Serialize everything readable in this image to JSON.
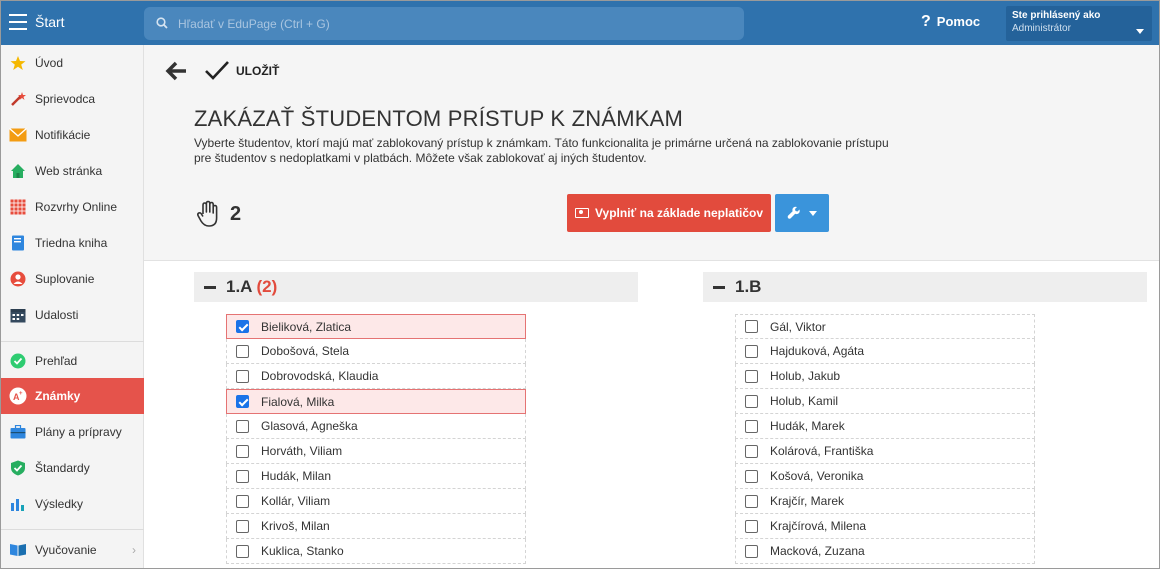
{
  "topbar": {
    "start_label": "Štart",
    "search_placeholder": "Hľadať v EduPage (Ctrl + G)",
    "help_label": "Pomoc",
    "user_line1": "Ste prihlásený ako",
    "user_line2": "Administrátor"
  },
  "sidebar": {
    "items": [
      {
        "label": "Úvod",
        "icon": "star-icon"
      },
      {
        "label": "Sprievodca",
        "icon": "magic-wand-icon"
      },
      {
        "label": "Notifikácie",
        "icon": "envelope-icon"
      },
      {
        "label": "Web stránka",
        "icon": "house-icon"
      },
      {
        "label": "Rozvrhy Online",
        "icon": "timetable-icon"
      },
      {
        "label": "Triedna kniha",
        "icon": "book-icon"
      },
      {
        "label": "Suplovanie",
        "icon": "substitute-icon"
      },
      {
        "label": "Udalosti",
        "icon": "calendar-icon"
      },
      {
        "label": "Prehľad",
        "icon": "check-circle-icon"
      },
      {
        "label": "Známky",
        "icon": "grades-icon"
      },
      {
        "label": "Plány a prípravy",
        "icon": "briefcase-icon"
      },
      {
        "label": "Štandardy",
        "icon": "shield-check-icon"
      },
      {
        "label": "Výsledky",
        "icon": "bar-chart-icon"
      },
      {
        "label": "Vyučovanie",
        "icon": "open-book-icon"
      }
    ],
    "active_index": 9
  },
  "toolbar": {
    "save_label": "ULOŽIŤ"
  },
  "page": {
    "title": "ZAKÁZAŤ ŠTUDENTOM PRÍSTUP K ZNÁMKAM",
    "description": "Vyberte študentov, ktorí majú mať zablokovaný prístup k známkam. Táto funkcionalita je primárne určená na zablokovanie prístupu pre študentov s nedoplatkami v platbách. Môžete však zablokovať aj iných študentov.",
    "blocked_count": "2",
    "fill_button_label": "Vyplniť na základe neplatičov"
  },
  "classes": [
    {
      "name": "1.A",
      "count_label": "(2)",
      "students": [
        {
          "name": "Bieliková, Zlatica",
          "checked": true
        },
        {
          "name": "Dobošová, Stela",
          "checked": false
        },
        {
          "name": "Dobrovodská, Klaudia",
          "checked": false
        },
        {
          "name": "Fialová, Milka",
          "checked": true
        },
        {
          "name": "Glasová, Agneška",
          "checked": false
        },
        {
          "name": "Horváth, Viliam",
          "checked": false
        },
        {
          "name": "Hudák, Milan",
          "checked": false
        },
        {
          "name": "Kollár, Viliam",
          "checked": false
        },
        {
          "name": "Krivoš, Milan",
          "checked": false
        },
        {
          "name": "Kuklica, Stanko",
          "checked": false
        }
      ]
    },
    {
      "name": "1.B",
      "count_label": "",
      "students": [
        {
          "name": "Gál, Viktor",
          "checked": false
        },
        {
          "name": "Hajduková, Agáta",
          "checked": false
        },
        {
          "name": "Holub, Jakub",
          "checked": false
        },
        {
          "name": "Holub, Kamil",
          "checked": false
        },
        {
          "name": "Hudák, Marek",
          "checked": false
        },
        {
          "name": "Kolárová, Františka",
          "checked": false
        },
        {
          "name": "Košová, Veronika",
          "checked": false
        },
        {
          "name": "Krajčír, Marek",
          "checked": false
        },
        {
          "name": "Krajčírová, Milena",
          "checked": false
        },
        {
          "name": "Macková, Zuzana",
          "checked": false
        }
      ]
    }
  ],
  "colors": {
    "topbar": "#2f72ad",
    "accent_red": "#e24b3d",
    "accent_blue": "#3a94db"
  }
}
